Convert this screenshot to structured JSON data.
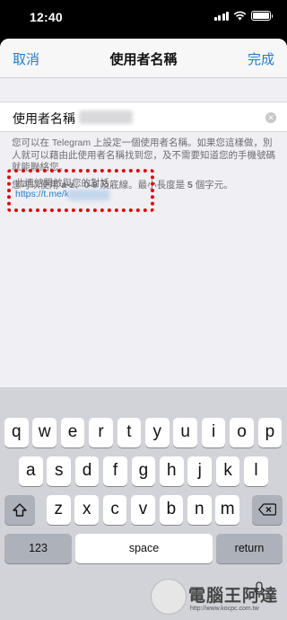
{
  "status": {
    "time": "12:40"
  },
  "nav": {
    "cancel": "取消",
    "title": "使用者名稱",
    "done": "完成"
  },
  "field": {
    "label": "使用者名稱"
  },
  "help": {
    "description": "您可以在 Telegram 上設定一個使用者名稱。如果您這樣做，別人就可以藉由此使用者名稱找到您，及不需要知道您的手機號碼就能聯絡您。",
    "rules_prefix": "您可以使用 ",
    "rules_az": "a-z",
    "rules_sep": "、",
    "rules_09": "0-9",
    "rules_mid": " 及底線。最小長度是 ",
    "rules_5": "5",
    "rules_suffix": " 個字元。"
  },
  "link": {
    "label": "此連結開啟與您的對話：",
    "url": "https://t.me/k"
  },
  "keyboard": {
    "row1": [
      "q",
      "w",
      "e",
      "r",
      "t",
      "y",
      "u",
      "i",
      "o",
      "p"
    ],
    "row2": [
      "a",
      "s",
      "d",
      "f",
      "g",
      "h",
      "j",
      "k",
      "l"
    ],
    "row3": [
      "z",
      "x",
      "c",
      "v",
      "b",
      "n",
      "m"
    ],
    "numbers": "123",
    "space": "space",
    "return": "return"
  },
  "watermark": {
    "text": "電腦王阿達",
    "url": "http://www.kocpc.com.tw"
  }
}
